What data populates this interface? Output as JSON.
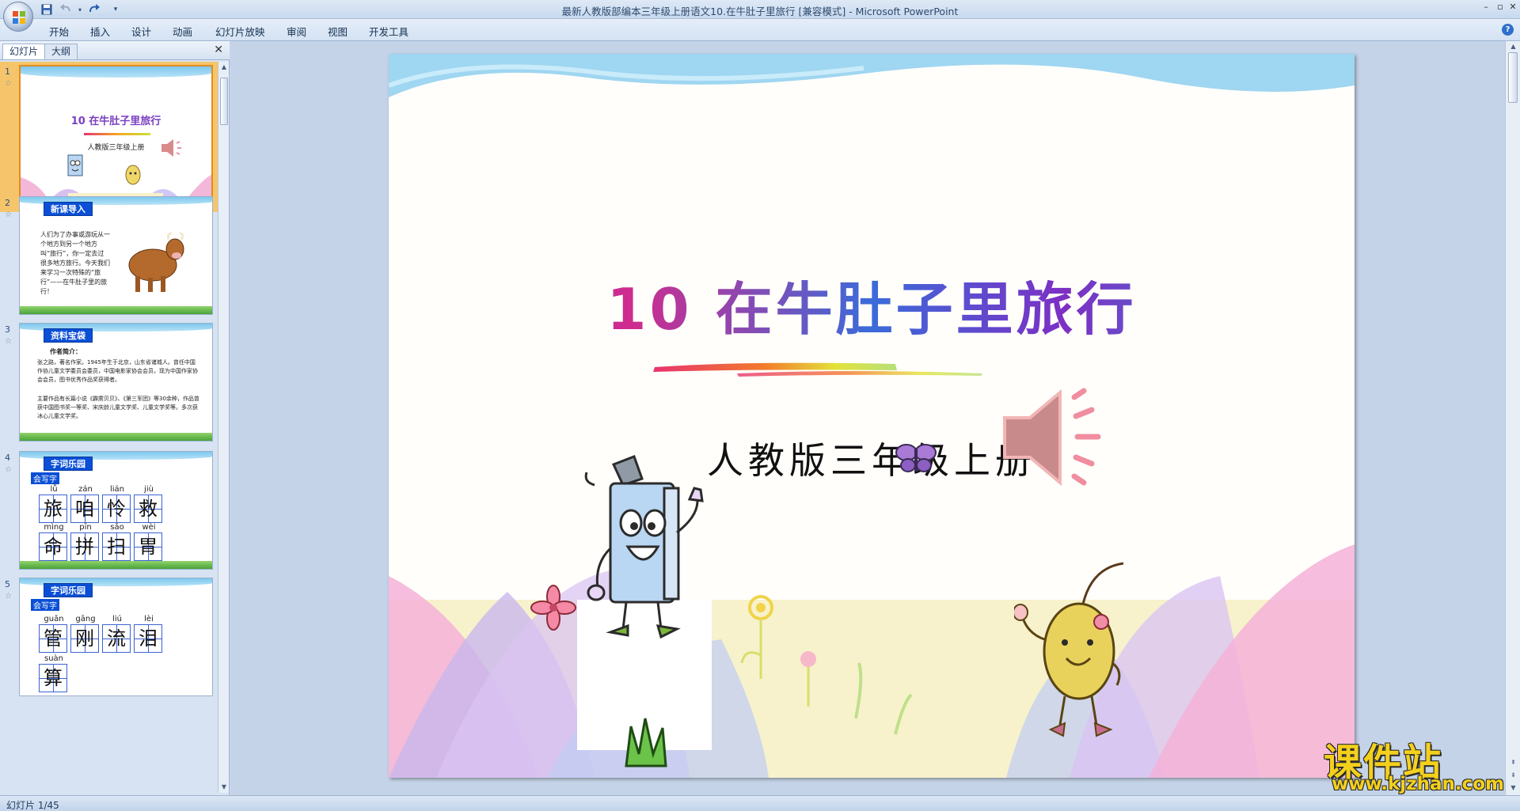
{
  "window": {
    "title": "最新人教版部编本三年级上册语文10.在牛肚子里旅行 [兼容模式] - Microsoft PowerPoint",
    "controls": [
      "–",
      "▫",
      "✕"
    ]
  },
  "quick_access": {
    "save_icon": "save-icon",
    "undo_icon": "undo-icon",
    "redo_icon": "redo-icon",
    "customize_icon": "dropdown-icon"
  },
  "ribbon": {
    "tabs": [
      "开始",
      "插入",
      "设计",
      "动画",
      "幻灯片放映",
      "审阅",
      "视图",
      "开发工具"
    ],
    "help": "?"
  },
  "left_pane": {
    "tabs": [
      "幻灯片",
      "大纲"
    ],
    "close": "✕",
    "slides": [
      {
        "num": "1",
        "title": "10 在牛肚子里旅行",
        "subtitle": "人教版三年级上册"
      },
      {
        "num": "2",
        "tag": "新课导入",
        "text": "人们为了办事或游玩从一个地方到另一个地方叫“旅行”，你一定去过很多地方旅行。今天我们来学习一次特殊的“旅行”——在牛肚子里的旅行！"
      },
      {
        "num": "3",
        "tag": "资料宝袋",
        "heading": "作者简介：",
        "text1": "张之路，著名作家。1945年生于北京，山东省诸城人。曾任中国作协儿童文学委员会委员，中国电影家协会会员，现为中国作家协会会员，图书优秀作品奖获得者。",
        "text2": "主要作品有长篇小说《霹雳贝贝》、《第三军团》等30余种，作品曾获中国图书奖一等奖、宋庆龄儿童文学奖、儿童文学奖等。多次获冰心儿童文学奖。"
      },
      {
        "num": "4",
        "tag": "字词乐园",
        "badge": "会写字",
        "chars": [
          {
            "py": "lǚ",
            "ch": "旅"
          },
          {
            "py": "zán",
            "ch": "咱"
          },
          {
            "py": "lián",
            "ch": "怜"
          },
          {
            "py": "jiù",
            "ch": "救"
          },
          {
            "py": "mìng",
            "ch": "命"
          },
          {
            "py": "pīn",
            "ch": "拼"
          },
          {
            "py": "sǎo",
            "ch": "扫"
          },
          {
            "py": "wèi",
            "ch": "胃"
          }
        ]
      },
      {
        "num": "5",
        "tag": "字词乐园",
        "badge": "会写字",
        "chars": [
          {
            "py": "guǎn",
            "ch": "管"
          },
          {
            "py": "gāng",
            "ch": "刚"
          },
          {
            "py": "liú",
            "ch": "流"
          },
          {
            "py": "lèi",
            "ch": "泪"
          },
          {
            "py": "suàn",
            "ch": "算"
          }
        ]
      }
    ]
  },
  "main_slide": {
    "title": "10 在牛肚子里旅行",
    "subtitle": "人教版三年级上册",
    "speaker_icon": "speaker-icon",
    "colors": {
      "wave": "#9fd6f1",
      "accent_pink": "#f08ea0"
    }
  },
  "status": {
    "slide_counter": "幻灯片 1/45"
  },
  "watermark": {
    "name": "课件站",
    "url": "www.kjzhan.com"
  }
}
